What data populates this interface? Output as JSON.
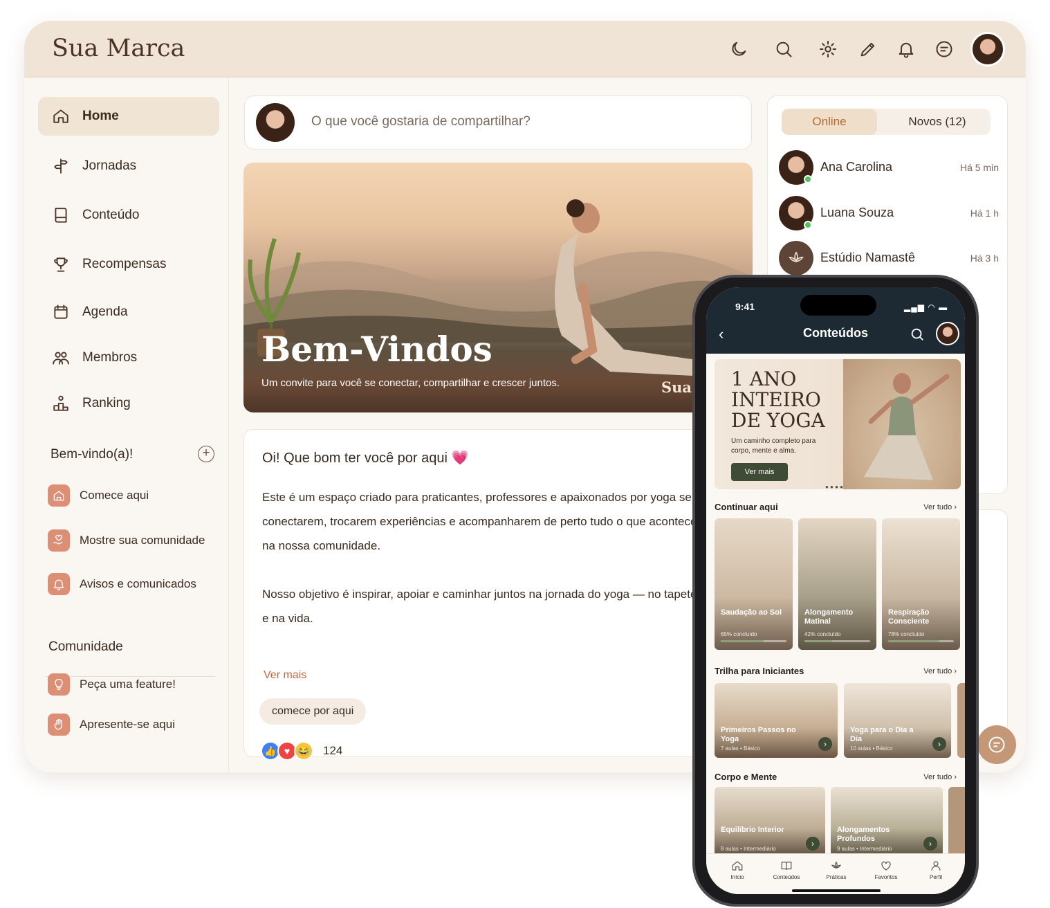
{
  "brand": "Sua Marca",
  "topbar": {
    "icons": [
      "moon-icon",
      "search-icon",
      "gear-icon",
      "pencil-icon",
      "bell-icon",
      "chat-icon"
    ]
  },
  "sidebar": {
    "items": [
      {
        "label": "Home",
        "icon": "home-icon"
      },
      {
        "label": "Jornadas",
        "icon": "signpost-icon"
      },
      {
        "label": "Conteúdo",
        "icon": "book-icon"
      },
      {
        "label": "Recompensas",
        "icon": "trophy-icon"
      },
      {
        "label": "Agenda",
        "icon": "calendar-icon"
      },
      {
        "label": "Membros",
        "icon": "users-icon"
      },
      {
        "label": "Ranking",
        "icon": "podium-icon"
      }
    ],
    "welcome_title": "Bem-vindo(a)!",
    "welcome_items": [
      {
        "label": "Comece aqui",
        "icon": "house-icon"
      },
      {
        "label": "Mostre sua comunidade",
        "icon": "heart-hand-icon"
      },
      {
        "label": "Avisos e comunicados",
        "icon": "bell-icon"
      }
    ],
    "community_title": "Comunidade",
    "community_items": [
      {
        "label": "Peça uma feature!",
        "icon": "bulb-icon"
      },
      {
        "label": "Apresente-se aqui",
        "icon": "hand-icon"
      }
    ]
  },
  "composer": {
    "placeholder": "O que você gostaria de compartilhar?"
  },
  "hero": {
    "title": "Bem-Vindos",
    "subtitle": "Um convite para você se conectar, compartilhar e crescer juntos.",
    "watermark": "Sua"
  },
  "post": {
    "heading": "Oi! Que bom ter você por aqui 💗",
    "paragraph1": "Este é um espaço criado para praticantes, professores e apaixonados por yoga se conectarem, trocarem experiências e acompanharem de perto tudo o que acontece na nossa comunidade.",
    "paragraph2": "Nosso objetivo é inspirar, apoiar e caminhar juntos na jornada do yoga — no tapete e na vida.",
    "more": "Ver mais",
    "tag": "comece por aqui",
    "reaction_count": "124"
  },
  "right_panel": {
    "tab_online": "Online",
    "tab_new": "Novos (12)",
    "members": [
      {
        "name": "Ana Carolina",
        "time": "Há 5 min"
      },
      {
        "name": "Luana Souza",
        "time": "Há 1 h"
      },
      {
        "name": "Estúdio Namastê",
        "time": "Há 3 h"
      }
    ]
  },
  "phone": {
    "time": "9:41",
    "title": "Conteúdos",
    "banner": {
      "title": "1 ANO INTEIRO DE YOGA",
      "subtitle": "Um caminho completo para corpo, mente e alma.",
      "button": "Ver mais"
    },
    "see_all": "Ver tudo",
    "continue": {
      "title": "Continuar aqui",
      "cards": [
        {
          "title": "Saudação ao Sol",
          "meta": "65% concluído",
          "progress": 0.65
        },
        {
          "title": "Alongamento Matinal",
          "meta": "42% concluído",
          "progress": 0.42
        },
        {
          "title": "Respiração Consciente",
          "meta": "78% concluído",
          "progress": 0.78
        }
      ]
    },
    "beginners": {
      "title": "Trilha para Iniciantes",
      "cards": [
        {
          "title": "Primeiros Passos no Yoga",
          "meta": "7 aulas • Básico"
        },
        {
          "title": "Yoga para o Dia a Dia",
          "meta": "10 aulas • Básico"
        }
      ]
    },
    "body_mind": {
      "title": "Corpo e Mente",
      "cards": [
        {
          "title": "Equilíbrio Interior",
          "meta": "8 aulas • Intermediário"
        },
        {
          "title": "Alongamentos Profundos",
          "meta": "9 aulas • Intermediário"
        }
      ]
    },
    "tabs": [
      "Início",
      "Conteúdos",
      "Práticas",
      "Favoritos",
      "Perfil"
    ]
  }
}
